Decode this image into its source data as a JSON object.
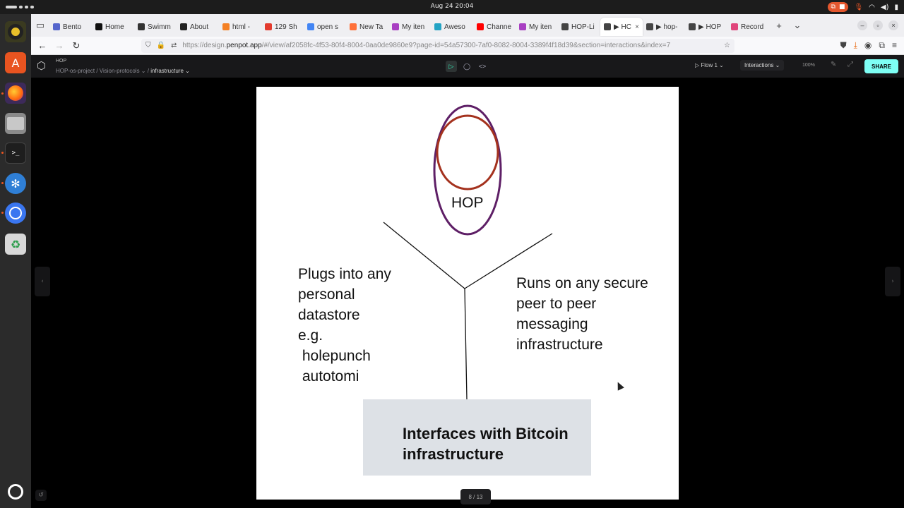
{
  "system": {
    "clock": "Aug 24  20:04"
  },
  "browser": {
    "tabs": [
      {
        "label": "Bento",
        "icon": "bento-icon",
        "color": "#5566cc"
      },
      {
        "label": "Home",
        "icon": "github-icon",
        "color": "#111111"
      },
      {
        "label": "Swimm",
        "icon": "wikipedia-icon",
        "color": "#333333"
      },
      {
        "label": "About",
        "icon": "d-icon",
        "color": "#222222"
      },
      {
        "label": "html -",
        "icon": "stackoverflow-icon",
        "color": "#f48024"
      },
      {
        "label": "129 Sh",
        "icon": "colorgrid-icon",
        "color": "#e33b2e"
      },
      {
        "label": "open s",
        "icon": "google-icon",
        "color": "#4285f4"
      },
      {
        "label": "New Ta",
        "icon": "firefox-icon",
        "color": "#ff7139"
      },
      {
        "label": "My iten",
        "icon": "app-icon",
        "color": "#a83fc2"
      },
      {
        "label": "Aweso",
        "icon": "app-icon",
        "color": "#23a3c4"
      },
      {
        "label": "Channe",
        "icon": "youtube-icon",
        "color": "#ff0000"
      },
      {
        "label": "My iten",
        "icon": "app-icon",
        "color": "#a83fc2"
      },
      {
        "label": "HOP-Li",
        "icon": "penpot-icon",
        "color": "#444444"
      },
      {
        "label": "▶ HC",
        "icon": "penpot-icon",
        "color": "#444444",
        "active": true
      },
      {
        "label": "▶ hop-",
        "icon": "penpot-icon",
        "color": "#444444"
      },
      {
        "label": "▶ HOP",
        "icon": "penpot-icon",
        "color": "#444444"
      },
      {
        "label": "Record",
        "icon": "record-icon",
        "color": "#e0457b"
      }
    ],
    "url_prefix": "https://design.",
    "url_domain": "penpot.app",
    "url_rest": "/#/view/af2058fc-4f53-80f4-8004-0aa0de9860e9?page-id=54a57300-7af0-8082-8004-3389f4f18d39&section=interactions&index=7"
  },
  "penpot": {
    "project_name": "HOP",
    "crumb_team": "HOP-os-project / Vision-protocols",
    "crumb_separator": "/",
    "crumb_page": "infrastructure",
    "flow": "Flow 1",
    "mode": "Interactions",
    "zoom": "100%",
    "share": "SHARE",
    "page_indicator": "8 / 13"
  },
  "board": {
    "hop_label": "HOP",
    "left_text": "Plugs into any\npersonal\ndatastore\ne.g.\n holepunch\n autotomi",
    "right_text": "Runs on any secure\npeer to peer\nmessaging\ninfrastructure",
    "bitcoin_text": "Interfaces with Bitcoin\ninfrastructure"
  }
}
